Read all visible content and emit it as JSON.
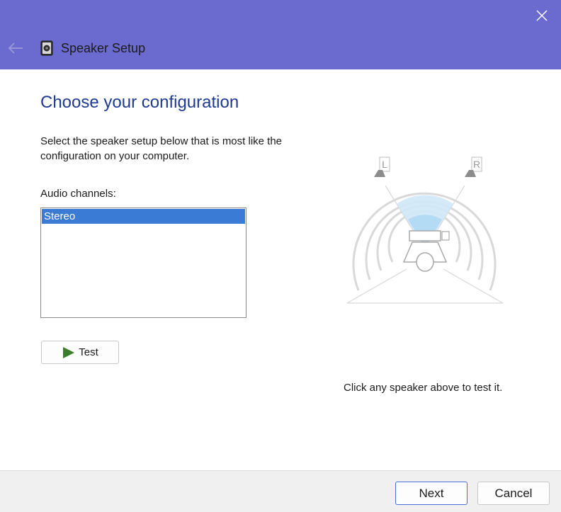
{
  "window": {
    "title": "Speaker Setup",
    "back_icon": "back-arrow-icon",
    "close_icon": "close-icon",
    "app_icon": "speaker-icon",
    "titlebar_color": "#6b6bcf"
  },
  "content": {
    "heading": "Choose your configuration",
    "description": "Select the speaker setup below that is most like the configuration on your computer.",
    "channels_label": "Audio channels:",
    "channels": [
      "Stereo"
    ],
    "selected_channel": "Stereo",
    "test_button": "Test",
    "test_icon": "play-icon",
    "hint": "Click any speaker above to test it."
  },
  "diagram": {
    "left_speaker_label": "L",
    "right_speaker_label": "R"
  },
  "footer": {
    "next_label": "Next",
    "cancel_label": "Cancel"
  }
}
